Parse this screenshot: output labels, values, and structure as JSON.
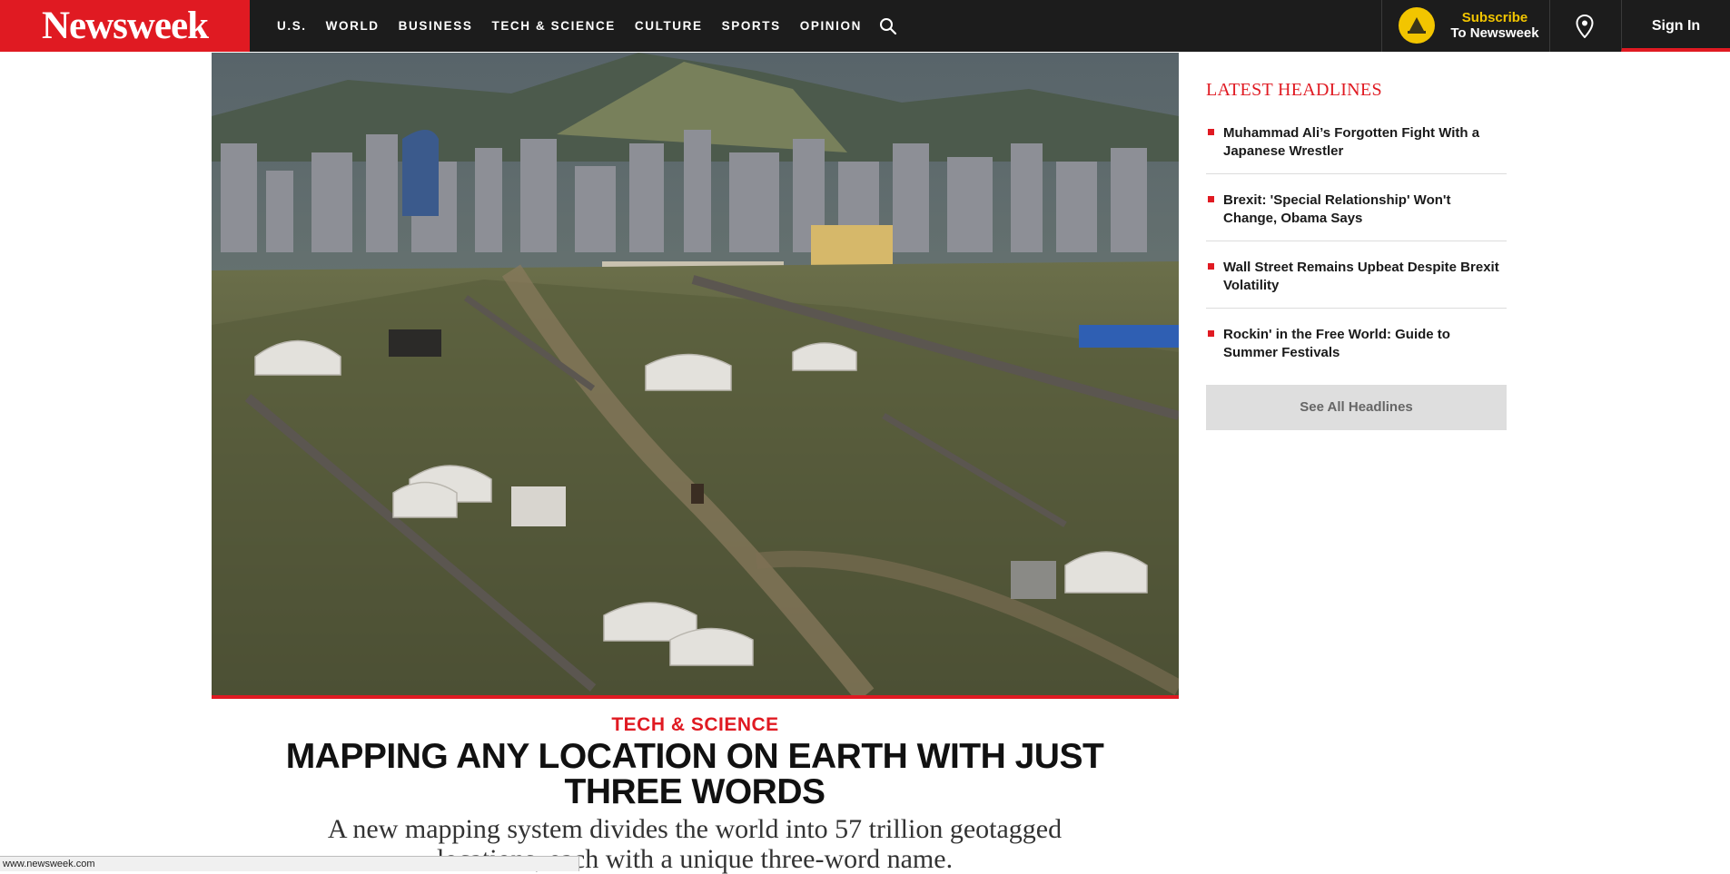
{
  "brand": {
    "logo_text": "Newsweek",
    "accent_color": "#e01a22",
    "nav_bg": "#1c1c1c"
  },
  "nav": {
    "items": [
      "U.S.",
      "WORLD",
      "BUSINESS",
      "TECH & SCIENCE",
      "CULTURE",
      "SPORTS",
      "OPINION"
    ],
    "search_icon": "search-icon"
  },
  "subscribe": {
    "line1": "Subscribe",
    "line2": "To Newsweek",
    "icon": "newsweek-badge-icon"
  },
  "location_icon": "map-pin-icon",
  "signin": {
    "label": "Sign In"
  },
  "hero": {
    "alt": "yurts on a hillside before a city skyline"
  },
  "article": {
    "section": "TECH & SCIENCE",
    "headline": "MAPPING ANY LOCATION ON EARTH WITH JUST THREE WORDS",
    "dek": "A new mapping system divides the world into 57 trillion geotagged locations, each with a unique three-word name."
  },
  "sidebar": {
    "title": "LATEST HEADLINES",
    "headlines": [
      "Muhammad Ali’s Forgotten Fight With a Japanese Wrestler",
      "Brexit: 'Special Relationship' Won't Change, Obama Says",
      "Wall Street Remains Upbeat Despite Brexit Volatility",
      "Rockin' in the Free World: Guide to Summer Festivals"
    ],
    "see_all": "See All Headlines"
  },
  "statusbar": {
    "url": "www.newsweek.com"
  }
}
